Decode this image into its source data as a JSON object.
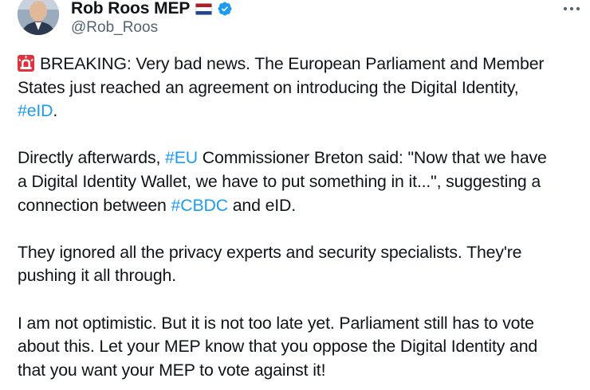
{
  "author": {
    "display_name": "Rob Roos MEP",
    "handle": "@Rob_Roos",
    "flag_icon": "netherlands-flag-icon",
    "verified_icon": "verified-badge-icon",
    "verified_color": "#1d9bf0"
  },
  "more_icon": "more-options-icon",
  "tweet": {
    "siren_icon": "rotating-light-icon",
    "p1": {
      "l1": "BREAKING: Very bad news. The European Parliament and Member",
      "l2": "States just reached an agreement on introducing the Digital Identity,",
      "l3_tag": "#eID",
      "l3_rest": "."
    },
    "p2": {
      "l1_pre": "Directly afterwards, ",
      "l1_tag": "#EU",
      "l1_post": " Commissioner Breton said: \"Now that we have",
      "l2": "a Digital Identity Wallet, we have to put something in it...\", suggesting a",
      "l3_pre": "connection between ",
      "l3_tag": "#CBDC",
      "l3_post": " and eID."
    },
    "p3": {
      "l1": "They ignored all the privacy experts and security specialists. They're",
      "l2": "pushing it all through."
    },
    "p4": {
      "l1": "I am not optimistic. But it is not too late yet. Parliament still has to vote",
      "l2": "about this. Let your MEP know that you oppose the Digital Identity and",
      "l3": "that you want your MEP to vote against it!"
    }
  },
  "colors": {
    "text": "#0f1419",
    "secondary": "#536471",
    "link": "#1d9bf0"
  }
}
